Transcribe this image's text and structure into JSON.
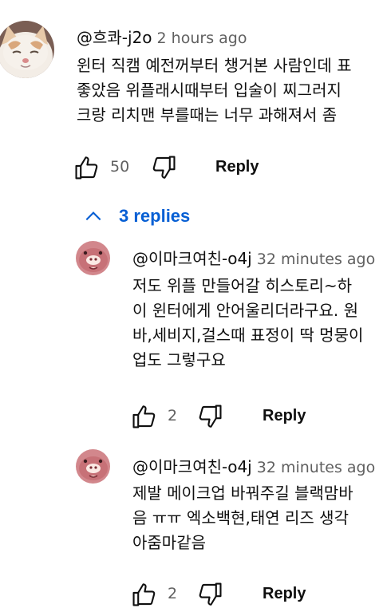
{
  "comment": {
    "author": "@흐콰-j2o",
    "time": "2 hours ago",
    "lines": [
      "윈터 직캠 예전꺼부터 챙거본 사람인데 표",
      "좋았음 위플래시때부터 입술이 찌그러지",
      "크랑 리치맨 부를때는 너무 과해져서 좀"
    ],
    "likes": "50",
    "reply_label": "Reply",
    "avatar_icon": "cat-avatar-icon"
  },
  "replies_toggle": {
    "label": "3 replies",
    "icon": "chevron-up-icon"
  },
  "replies": [
    {
      "author": "@이마크여친-o4j",
      "time": "32 minutes ago",
      "lines": [
        "저도 위플 만들어갈 히스토리~하",
        "이 윈터에게 안어울리더라구요. 원",
        "바,세비지,걸스때 표정이 딱 멍뭉이",
        "업도 그렇구요"
      ],
      "likes": "2",
      "reply_label": "Reply",
      "avatar_icon": "pig-avatar-icon"
    },
    {
      "author": "@이마크여친-o4j",
      "time": "32 minutes ago",
      "lines": [
        "제발 메이크업 바꿔주길 블랙맘바",
        "음 ㅠㅠ 엑소백현,태연 리즈 생각",
        "아줌마같음"
      ],
      "likes": "2",
      "reply_label": "Reply",
      "avatar_icon": "pig-avatar-icon"
    }
  ],
  "colors": {
    "link_blue": "#065fd4",
    "secondary_text": "#606060",
    "primary_text": "#0f0f0f"
  }
}
